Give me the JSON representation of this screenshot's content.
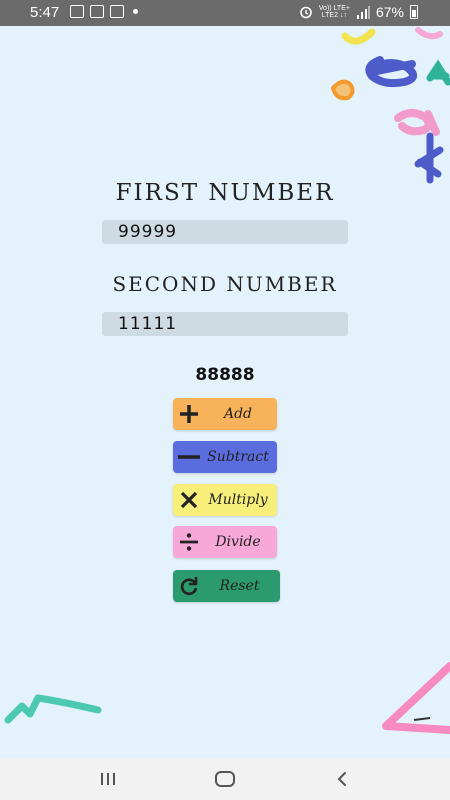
{
  "status_bar": {
    "time": "5:47",
    "network_top": "Vo)) LTE+",
    "network_bottom": "LTE2 ↓↑",
    "battery_percent": "67%"
  },
  "labels": {
    "first_number": "FIRST NUMBER",
    "second_number": "SECOND NUMBER"
  },
  "inputs": {
    "first_value": "99999",
    "second_value": "11111"
  },
  "result": "88888",
  "buttons": {
    "add": "Add",
    "subtract": "Subtract",
    "multiply": "Multiply",
    "divide": "Divide",
    "reset": "Reset"
  },
  "colors": {
    "background": "#e3f2fb",
    "add": "#f7b25a",
    "subtract": "#5b6dde",
    "multiply": "#f7ef7a",
    "divide": "#f7a8d8",
    "reset": "#2b9a6d"
  },
  "icons": {
    "add": "plus-icon",
    "subtract": "minus-icon",
    "multiply": "times-icon",
    "divide": "divide-icon",
    "reset": "refresh-icon",
    "nav_recent": "recent-apps-icon",
    "nav_home": "home-icon",
    "nav_back": "back-icon"
  }
}
